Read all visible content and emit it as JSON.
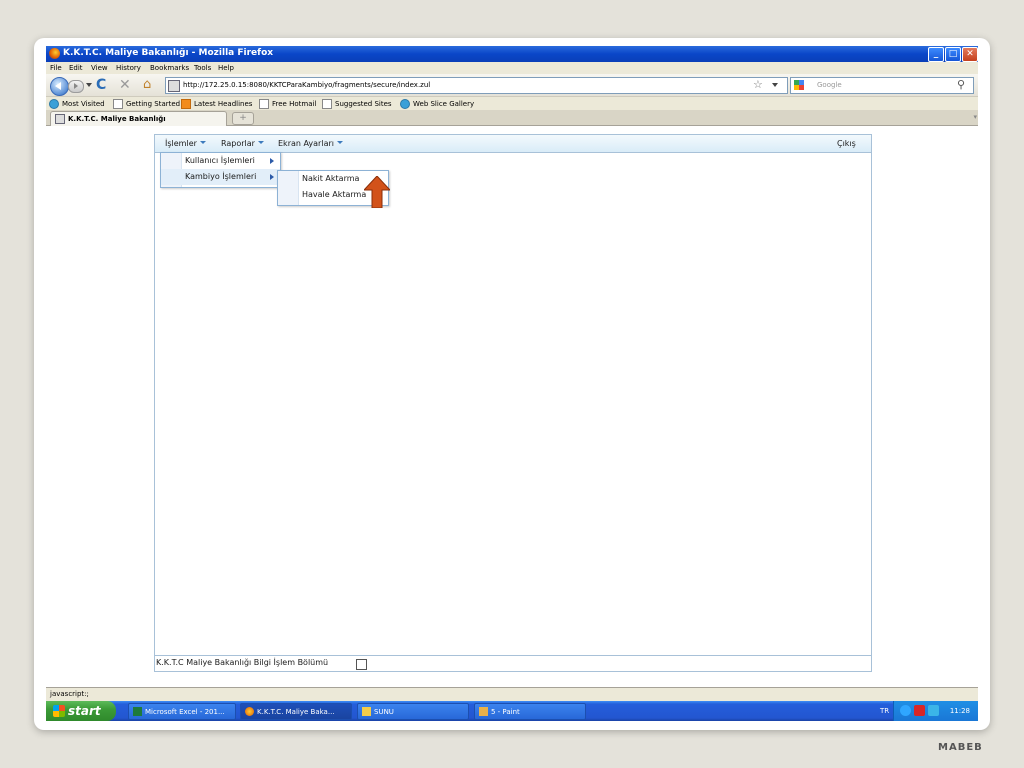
{
  "window": {
    "title": "K.K.T.C. Maliye Bakanlığı - Mozilla Firefox",
    "controls": {
      "minimize": "_",
      "maximize": "□",
      "close": "✕"
    }
  },
  "browser_menu": [
    "File",
    "Edit",
    "View",
    "History",
    "Bookmarks",
    "Tools",
    "Help"
  ],
  "navbar": {
    "url": "http://172.25.0.15:8080/KKTCParaKambiyo/fragments/secure/index.zul",
    "search_placeholder": "Google",
    "icons": {
      "back": "back-icon",
      "forward": "forward-icon",
      "reload": "reload-icon",
      "stop": "stop-icon",
      "home": "home-icon",
      "bookmark": "star-icon",
      "search": "magnifier-icon"
    }
  },
  "bookmarks": [
    "Most Visited",
    "Getting Started",
    "Latest Headlines",
    "Free Hotmail",
    "Suggested Sites",
    "Web Slice Gallery"
  ],
  "tab": {
    "label": "K.K.T.C. Maliye Bakanlığı",
    "new_tab": "+"
  },
  "app": {
    "menu": {
      "islemler": "İşlemler",
      "raporlar": "Raporlar",
      "ekran_ayarlari": "Ekran Ayarları",
      "cikis": "Çıkış"
    },
    "dropdown": [
      "Kullanıcı İşlemleri",
      "Kambiyo İşlemleri"
    ],
    "submenu": [
      "Nakit Aktarma",
      "Havale Aktarma"
    ],
    "footer": "K.K.T.C Maliye Bakanlığı Bilgi İşlem Bölümü",
    "annotation_color": "#d2521a"
  },
  "status": "javascript:;",
  "taskbar": {
    "start": "start",
    "tasks": [
      "Microsoft Excel - 201...",
      "K.K.T.C. Maliye Baka...",
      "SUNU",
      "5 - Paint"
    ],
    "lang": "TR",
    "clock": "11:28"
  },
  "brand": "MABEB"
}
